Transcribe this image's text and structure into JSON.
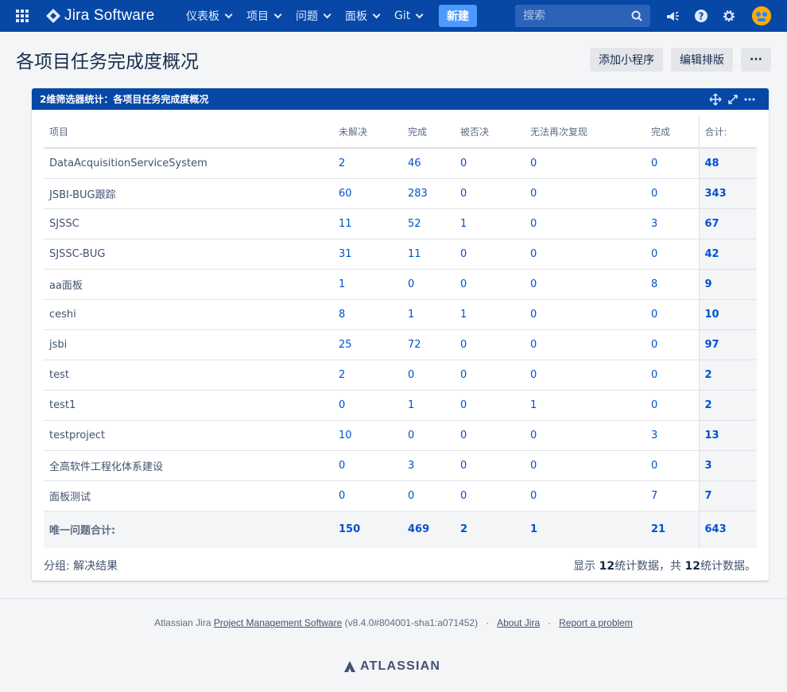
{
  "nav": {
    "logo_text": "Jira Software",
    "menus": [
      "仪表板",
      "项目",
      "问题",
      "面板",
      "Git"
    ],
    "create_label": "新建",
    "search_placeholder": "搜索"
  },
  "page": {
    "title": "各项目任务完成度概况",
    "add_gadget_label": "添加小程序",
    "edit_layout_label": "编辑排版",
    "more_label": "···"
  },
  "gadget": {
    "title": "2维筛选器统计：各项目任务完成度概况",
    "columns": [
      "项目",
      "未解决",
      "完成",
      "被否决",
      "无法再次复现",
      "完成",
      "合计:"
    ],
    "rows": [
      {
        "name": "DataAcquisitionServiceSystem",
        "values": [
          "2",
          "46",
          "0",
          "0",
          "0"
        ],
        "total": "48"
      },
      {
        "name": "JSBI-BUG跟踪",
        "values": [
          "60",
          "283",
          "0",
          "0",
          "0"
        ],
        "total": "343"
      },
      {
        "name": "SJSSC",
        "values": [
          "11",
          "52",
          "1",
          "0",
          "3"
        ],
        "total": "67"
      },
      {
        "name": "SJSSC-BUG",
        "values": [
          "31",
          "11",
          "0",
          "0",
          "0"
        ],
        "total": "42"
      },
      {
        "name": "aa面板",
        "values": [
          "1",
          "0",
          "0",
          "0",
          "8"
        ],
        "total": "9"
      },
      {
        "name": "ceshi",
        "values": [
          "8",
          "1",
          "1",
          "0",
          "0"
        ],
        "total": "10"
      },
      {
        "name": "jsbi",
        "values": [
          "25",
          "72",
          "0",
          "0",
          "0"
        ],
        "total": "97"
      },
      {
        "name": "test",
        "values": [
          "2",
          "0",
          "0",
          "0",
          "0"
        ],
        "total": "2"
      },
      {
        "name": "test1",
        "values": [
          "0",
          "1",
          "0",
          "1",
          "0"
        ],
        "total": "2"
      },
      {
        "name": "testproject",
        "values": [
          "10",
          "0",
          "0",
          "0",
          "3"
        ],
        "total": "13"
      },
      {
        "name": "全高软件工程化体系建设",
        "values": [
          "0",
          "3",
          "0",
          "0",
          "0"
        ],
        "total": "3"
      },
      {
        "name": "面板测试",
        "values": [
          "0",
          "0",
          "0",
          "0",
          "7"
        ],
        "total": "7"
      }
    ],
    "summary": {
      "label": "唯一问题合计:",
      "values": [
        "150",
        "469",
        "2",
        "1",
        "21"
      ],
      "total": "643"
    },
    "group_by": "分组: 解决结果",
    "stats_prefix": "显示 ",
    "stats_count_shown": "12",
    "stats_mid": "统计数据，共 ",
    "stats_count_total": "12",
    "stats_suffix": "统计数据。"
  },
  "footer": {
    "prefix": "Atlassian Jira ",
    "pms_link": "Project Management Software",
    "version": " (v8.4.0#804001-sha1:a071452)",
    "about_link": "About Jira",
    "report_link": "Report a problem",
    "atlassian": "ATLASSIAN"
  },
  "colors": {
    "nav_bg": "#0747a6",
    "link": "#0052cc",
    "create_btn": "#4c9aff"
  }
}
